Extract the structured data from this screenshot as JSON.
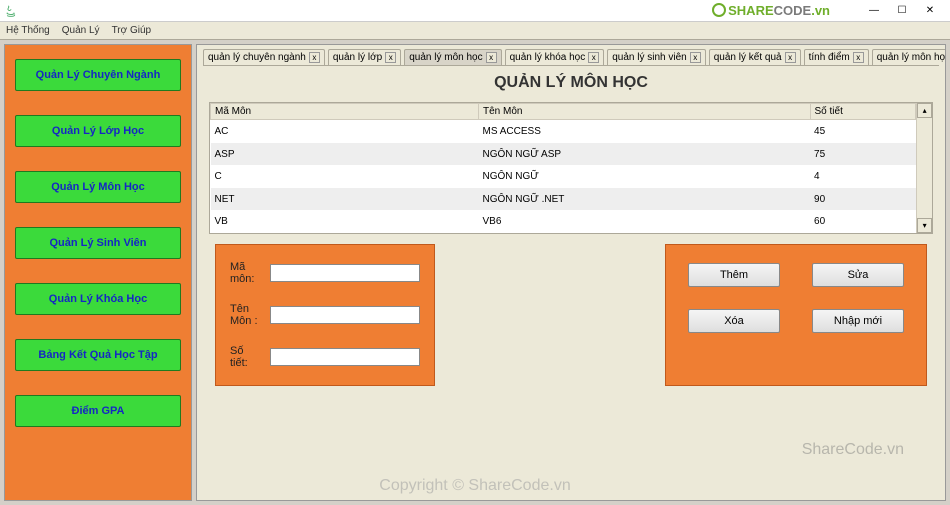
{
  "window": {
    "logo_text_1": "SHARE",
    "logo_text_2": "CODE",
    "logo_suffix": ".vn"
  },
  "menubar": [
    "Hệ Thống",
    "Quản Lý",
    "Trợ Giúp"
  ],
  "sidebar": {
    "items": [
      {
        "label": "Quản Lý Chuyên Ngành"
      },
      {
        "label": "Quản Lý Lớp Học"
      },
      {
        "label": "Quản Lý Môn Học"
      },
      {
        "label": "Quản Lý Sinh Viên"
      },
      {
        "label": "Quản Lý Khóa Học"
      },
      {
        "label": "Bảng Kết Quả Học Tập"
      },
      {
        "label": "Điểm GPA"
      }
    ]
  },
  "tabs": [
    {
      "label": "quản lý chuyên ngành",
      "closable": true
    },
    {
      "label": "quản lý lớp",
      "closable": true
    },
    {
      "label": "quản lý môn học",
      "closable": true,
      "active": true
    },
    {
      "label": "quản lý khóa học",
      "closable": true
    },
    {
      "label": "quản lý sinh viên",
      "closable": true
    },
    {
      "label": "quản lý kết quả",
      "closable": true
    },
    {
      "label": "tính điểm",
      "closable": true
    },
    {
      "label": "quản lý môn học",
      "closable": false
    }
  ],
  "page": {
    "title": "QUẢN LÝ MÔN HỌC"
  },
  "table": {
    "columns": [
      "Mã Môn",
      "Tên Môn",
      "Số tiết"
    ],
    "rows": [
      [
        "AC",
        "MS ACCESS",
        "45"
      ],
      [
        "ASP",
        "NGÔN NGỮ ASP",
        "75"
      ],
      [
        "C",
        "NGÔN NGỮ",
        "4"
      ],
      [
        "NET",
        "NGÔN NGỮ .NET",
        "90"
      ],
      [
        "VB",
        "VB6",
        "60"
      ]
    ]
  },
  "form": {
    "fields": [
      {
        "label": "Mã môn:",
        "value": ""
      },
      {
        "label": "Tên Môn :",
        "value": ""
      },
      {
        "label": "Số tiết:",
        "value": ""
      }
    ],
    "actions": {
      "add": "Thêm",
      "edit": "Sửa",
      "delete": "Xóa",
      "new": "Nhập mới"
    }
  },
  "watermark": {
    "brand": "ShareCode.vn",
    "copyright": "Copyright © ShareCode.vn"
  }
}
